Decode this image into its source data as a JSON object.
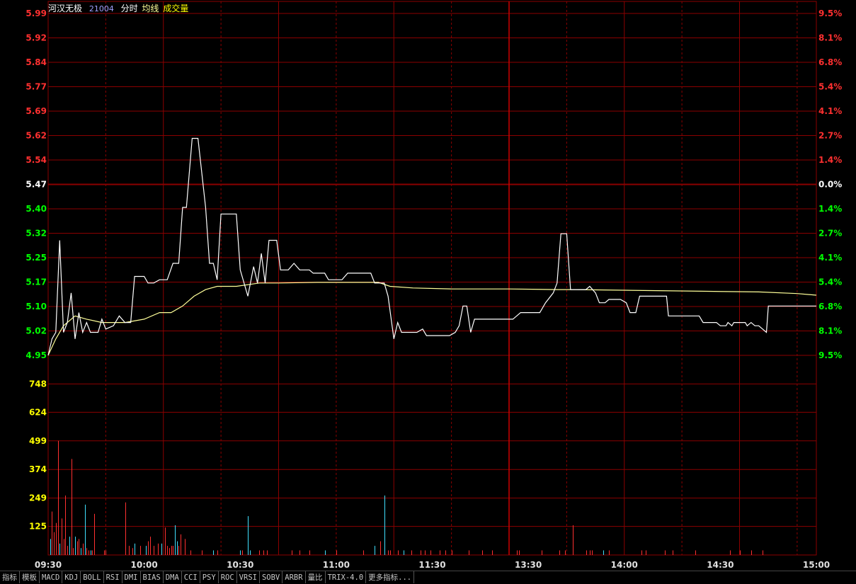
{
  "header": {
    "stock_name": "河汉无极",
    "stock_code": "21004",
    "label_intraday": "分时",
    "label_avg": "均线",
    "label_volume": "成交量"
  },
  "colors": {
    "grid": "#8b0000",
    "up": "#ff3030",
    "down": "#00ff00",
    "neutral": "#ffffff",
    "price_line": "#ffffff",
    "avg_line": "#ffff99",
    "vol_up": "#ff3030",
    "vol_down": "#40e0ff",
    "vol_label": "#ffff00"
  },
  "chart_data": {
    "type": "line",
    "x_ticks": [
      "09:30",
      "10:00",
      "10:30",
      "11:00",
      "11:30",
      "13:30",
      "14:00",
      "14:30",
      "15:00"
    ],
    "price_axis": {
      "ticks": [
        "5.99",
        "5.92",
        "5.84",
        "5.77",
        "5.69",
        "5.62",
        "5.54",
        "5.47",
        "5.40",
        "5.32",
        "5.25",
        "5.17",
        "5.10",
        "5.02",
        "4.95"
      ],
      "pct_ticks": [
        "9.5%",
        "8.1%",
        "6.8%",
        "5.4%",
        "4.1%",
        "2.7%",
        "1.4%",
        "0.0%",
        "1.4%",
        "2.7%",
        "4.1%",
        "5.4%",
        "6.8%",
        "8.1%",
        "9.5%"
      ],
      "ylim": [
        4.95,
        5.99
      ],
      "prev_close": 5.47
    },
    "volume_axis": {
      "ticks": [
        "748",
        "624",
        "499",
        "374",
        "249",
        "125"
      ],
      "ylim": [
        0,
        873
      ]
    },
    "price": [
      [
        0,
        4.95
      ],
      [
        2,
        5.0
      ],
      [
        4,
        5.02
      ],
      [
        6,
        5.3
      ],
      [
        8,
        5.02
      ],
      [
        10,
        5.05
      ],
      [
        12,
        5.14
      ],
      [
        14,
        5.0
      ],
      [
        16,
        5.08
      ],
      [
        18,
        5.02
      ],
      [
        20,
        5.05
      ],
      [
        22,
        5.02
      ],
      [
        26,
        5.02
      ],
      [
        28,
        5.06
      ],
      [
        30,
        5.03
      ],
      [
        34,
        5.04
      ],
      [
        37,
        5.07
      ],
      [
        40,
        5.05
      ],
      [
        43,
        5.05
      ],
      [
        45,
        5.19
      ],
      [
        50,
        5.19
      ],
      [
        52,
        5.17
      ],
      [
        55,
        5.17
      ],
      [
        58,
        5.18
      ],
      [
        62,
        5.18
      ],
      [
        65,
        5.23
      ],
      [
        68,
        5.23
      ],
      [
        70,
        5.4
      ],
      [
        72,
        5.4
      ],
      [
        75,
        5.61
      ],
      [
        78,
        5.61
      ],
      [
        82,
        5.4
      ],
      [
        84,
        5.23
      ],
      [
        86,
        5.23
      ],
      [
        88,
        5.18
      ],
      [
        90,
        5.38
      ],
      [
        95,
        5.38
      ],
      [
        98,
        5.38
      ],
      [
        100,
        5.21
      ],
      [
        104,
        5.13
      ],
      [
        107,
        5.22
      ],
      [
        109,
        5.17
      ],
      [
        111,
        5.26
      ],
      [
        113,
        5.17
      ],
      [
        115,
        5.3
      ],
      [
        119,
        5.3
      ],
      [
        121,
        5.21
      ],
      [
        125,
        5.21
      ],
      [
        128,
        5.23
      ],
      [
        131,
        5.21
      ],
      [
        136,
        5.21
      ],
      [
        138,
        5.2
      ],
      [
        144,
        5.2
      ],
      [
        146,
        5.18
      ],
      [
        153,
        5.18
      ],
      [
        156,
        5.2
      ],
      [
        163,
        5.2
      ],
      [
        168,
        5.2
      ],
      [
        170,
        5.17
      ],
      [
        175,
        5.17
      ],
      [
        177,
        5.13
      ],
      [
        180,
        5.0
      ],
      [
        182,
        5.05
      ],
      [
        184,
        5.02
      ],
      [
        188,
        5.02
      ],
      [
        192,
        5.02
      ],
      [
        195,
        5.03
      ],
      [
        197,
        5.01
      ],
      [
        200,
        5.01
      ],
      [
        209,
        5.01
      ],
      [
        212,
        5.02
      ],
      [
        214,
        5.04
      ],
      [
        216,
        5.1
      ],
      [
        218,
        5.1
      ],
      [
        220,
        5.02
      ],
      [
        222,
        5.06
      ],
      [
        227,
        5.06
      ],
      [
        236,
        5.06
      ],
      [
        242,
        5.06
      ],
      [
        246,
        5.08
      ],
      [
        252,
        5.08
      ],
      [
        256,
        5.08
      ],
      [
        259,
        5.11
      ],
      [
        263,
        5.14
      ],
      [
        265,
        5.17
      ],
      [
        267,
        5.32
      ],
      [
        270,
        5.32
      ],
      [
        272,
        5.15
      ],
      [
        280,
        5.15
      ],
      [
        282,
        5.16
      ],
      [
        285,
        5.14
      ],
      [
        287,
        5.11
      ],
      [
        290,
        5.11
      ],
      [
        292,
        5.12
      ],
      [
        298,
        5.12
      ],
      [
        301,
        5.11
      ],
      [
        303,
        5.08
      ],
      [
        306,
        5.08
      ],
      [
        308,
        5.13
      ],
      [
        314,
        5.13
      ],
      [
        322,
        5.13
      ],
      [
        323,
        5.07
      ],
      [
        327,
        5.07
      ],
      [
        331,
        5.07
      ],
      [
        339,
        5.07
      ],
      [
        341,
        5.05
      ],
      [
        348,
        5.05
      ],
      [
        350,
        5.04
      ],
      [
        353,
        5.04
      ],
      [
        354,
        5.05
      ],
      [
        356,
        5.04
      ],
      [
        357,
        5.05
      ],
      [
        361,
        5.05
      ],
      [
        363,
        5.05
      ],
      [
        364,
        5.04
      ],
      [
        366,
        5.05
      ],
      [
        368,
        5.04
      ],
      [
        370,
        5.04
      ],
      [
        372,
        5.03
      ],
      [
        374,
        5.02
      ],
      [
        375,
        5.1
      ],
      [
        380,
        5.1
      ],
      [
        390,
        5.1
      ],
      [
        396,
        5.1
      ],
      [
        400,
        5.1
      ]
    ],
    "avg": [
      [
        0,
        4.95
      ],
      [
        4,
        5.0
      ],
      [
        8,
        5.04
      ],
      [
        14,
        5.07
      ],
      [
        20,
        5.06
      ],
      [
        28,
        5.05
      ],
      [
        40,
        5.05
      ],
      [
        50,
        5.06
      ],
      [
        58,
        5.08
      ],
      [
        64,
        5.08
      ],
      [
        70,
        5.1
      ],
      [
        76,
        5.13
      ],
      [
        82,
        5.15
      ],
      [
        88,
        5.16
      ],
      [
        98,
        5.16
      ],
      [
        110,
        5.17
      ],
      [
        120,
        5.17
      ],
      [
        140,
        5.172
      ],
      [
        160,
        5.172
      ],
      [
        172,
        5.172
      ],
      [
        178,
        5.16
      ],
      [
        190,
        5.155
      ],
      [
        210,
        5.152
      ],
      [
        240,
        5.152
      ],
      [
        265,
        5.15
      ],
      [
        275,
        5.15
      ],
      [
        300,
        5.148
      ],
      [
        340,
        5.145
      ],
      [
        370,
        5.143
      ],
      [
        390,
        5.138
      ],
      [
        400,
        5.133
      ]
    ],
    "volume": [
      [
        1,
        70,
        0
      ],
      [
        2,
        190,
        1
      ],
      [
        3,
        100,
        1
      ],
      [
        4,
        140,
        1
      ],
      [
        5,
        499,
        1
      ],
      [
        6,
        50,
        0
      ],
      [
        7,
        160,
        1
      ],
      [
        8,
        70,
        1
      ],
      [
        9,
        260,
        1
      ],
      [
        10,
        40,
        1
      ],
      [
        11,
        80,
        0
      ],
      [
        12,
        420,
        1
      ],
      [
        13,
        30,
        1
      ],
      [
        14,
        80,
        0
      ],
      [
        15,
        60,
        1
      ],
      [
        16,
        70,
        1
      ],
      [
        17,
        30,
        0
      ],
      [
        18,
        50,
        1
      ],
      [
        19,
        220,
        0
      ],
      [
        20,
        30,
        1
      ],
      [
        21,
        20,
        1
      ],
      [
        22,
        20,
        0
      ],
      [
        23,
        20,
        1
      ],
      [
        24,
        180,
        1
      ],
      [
        29,
        20,
        1
      ],
      [
        30,
        20,
        1
      ],
      [
        40,
        230,
        1
      ],
      [
        42,
        40,
        1
      ],
      [
        44,
        30,
        1
      ],
      [
        45,
        50,
        0
      ],
      [
        48,
        40,
        1
      ],
      [
        51,
        40,
        0
      ],
      [
        52,
        60,
        1
      ],
      [
        53,
        80,
        1
      ],
      [
        55,
        40,
        1
      ],
      [
        57,
        50,
        1
      ],
      [
        59,
        50,
        0
      ],
      [
        61,
        120,
        1
      ],
      [
        62,
        40,
        1
      ],
      [
        63,
        30,
        1
      ],
      [
        64,
        40,
        1
      ],
      [
        65,
        40,
        1
      ],
      [
        66,
        130,
        0
      ],
      [
        67,
        60,
        0
      ],
      [
        68,
        40,
        1
      ],
      [
        69,
        90,
        1
      ],
      [
        71,
        70,
        1
      ],
      [
        74,
        20,
        1
      ],
      [
        80,
        20,
        1
      ],
      [
        86,
        20,
        0
      ],
      [
        88,
        20,
        1
      ],
      [
        100,
        20,
        0
      ],
      [
        101,
        20,
        1
      ],
      [
        104,
        170,
        0
      ],
      [
        105,
        20,
        0
      ],
      [
        110,
        20,
        1
      ],
      [
        112,
        20,
        1
      ],
      [
        114,
        20,
        1
      ],
      [
        127,
        20,
        1
      ],
      [
        131,
        20,
        1
      ],
      [
        136,
        20,
        1
      ],
      [
        144,
        20,
        0
      ],
      [
        150,
        20,
        1
      ],
      [
        164,
        20,
        1
      ],
      [
        170,
        40,
        0
      ],
      [
        173,
        60,
        1
      ],
      [
        175,
        260,
        0
      ],
      [
        177,
        20,
        1
      ],
      [
        178,
        20,
        1
      ],
      [
        182,
        20,
        1
      ],
      [
        185,
        20,
        0
      ],
      [
        189,
        20,
        1
      ],
      [
        194,
        20,
        1
      ],
      [
        196,
        20,
        1
      ],
      [
        199,
        20,
        1
      ],
      [
        204,
        20,
        1
      ],
      [
        207,
        20,
        1
      ],
      [
        210,
        20,
        1
      ],
      [
        219,
        20,
        1
      ],
      [
        226,
        20,
        1
      ],
      [
        231,
        20,
        1
      ],
      [
        244,
        20,
        1
      ],
      [
        245,
        20,
        1
      ],
      [
        257,
        20,
        1
      ],
      [
        266,
        20,
        1
      ],
      [
        269,
        20,
        1
      ],
      [
        273,
        130,
        1
      ],
      [
        280,
        20,
        1
      ],
      [
        282,
        20,
        1
      ],
      [
        283,
        20,
        1
      ],
      [
        289,
        20,
        0
      ],
      [
        292,
        20,
        1
      ],
      [
        309,
        20,
        1
      ],
      [
        311,
        20,
        1
      ],
      [
        321,
        20,
        1
      ],
      [
        325,
        20,
        1
      ],
      [
        337,
        20,
        1
      ],
      [
        355,
        20,
        1
      ],
      [
        360,
        20,
        1
      ],
      [
        366,
        20,
        1
      ],
      [
        372,
        20,
        1
      ]
    ]
  },
  "indicator_tabs": [
    "指标",
    "模板",
    "MACD",
    "KDJ",
    "BOLL",
    "RSI",
    "DMI",
    "BIAS",
    "DMA",
    "CCI",
    "PSY",
    "ROC",
    "VRSI",
    "SOBV",
    "ARBR",
    "量比",
    "TRIX-4.0",
    "更多指标..."
  ]
}
